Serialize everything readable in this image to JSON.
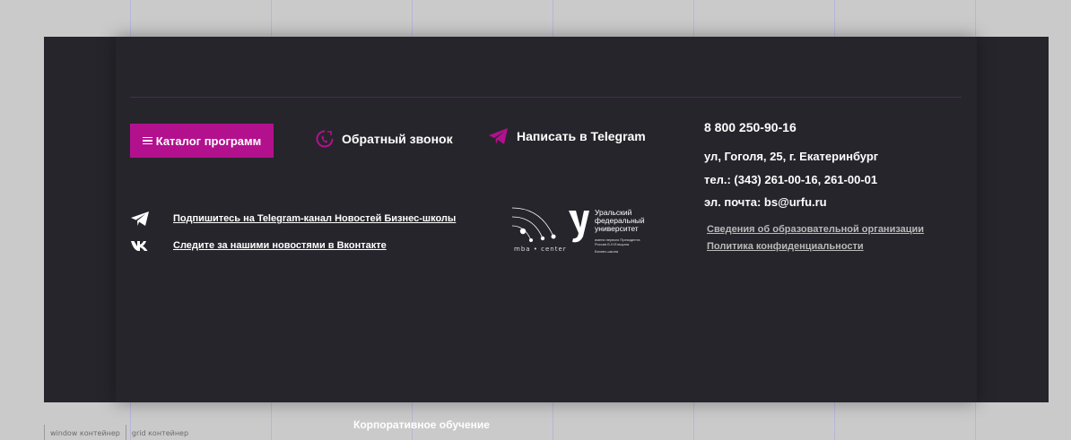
{
  "colors": {
    "accent": "#b3108e",
    "footer_bg": "#26252b",
    "page_bg": "#cacaca",
    "divider": "#4a2a55"
  },
  "footer": {
    "catalog_button": {
      "label": "Каталог программ",
      "icon": "menu-icon"
    },
    "callback": {
      "label": "Обратный звонок",
      "icon": "phone-callback-icon"
    },
    "telegram": {
      "label": "Написать в Telegram",
      "icon": "telegram-icon"
    },
    "contacts": {
      "phone": "8 800 250-90-16",
      "address": "ул, Гоголя, 25, г. Екатеринбург",
      "tel": "тел.: (343) 261-00-16, 261-00-01",
      "email": "эл. почта: bs@urfu.ru"
    },
    "legal_links": [
      "Сведения об образовательной организации",
      "Политика конфиденциальности"
    ],
    "social": [
      {
        "icon": "telegram-icon",
        "label": "Подпишитесь на Telegram-канал Новостей Бизнес-школы"
      },
      {
        "icon": "vk-icon",
        "label": "Следите за нашими новостями в Вконтакте"
      }
    ],
    "logos": {
      "mba_caption": "mba • center",
      "urfu_name": [
        "Уральский",
        "федеральный",
        "университет"
      ],
      "urfu_small": [
        "имени первого Президента",
        "России Б.Н.Ельцина"
      ],
      "urfu_school": "Бизнес-школа"
    }
  },
  "grid_labels": [
    "window контейнер",
    "grid контейнер"
  ],
  "below_footer_text": "Корпоративное обучение"
}
